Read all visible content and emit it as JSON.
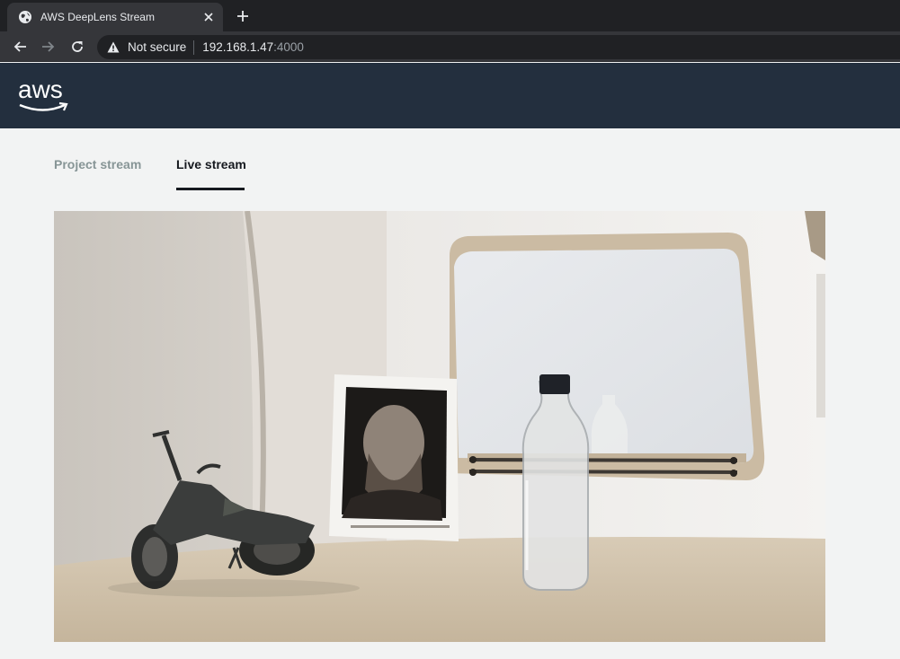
{
  "browser": {
    "tab_title": "AWS DeepLens Stream",
    "security_label": "Not secure",
    "url_host": "192.168.1.47",
    "url_port": ":4000",
    "icons": [
      "globe-icon",
      "close-icon",
      "plus-icon",
      "back-arrow-icon",
      "forward-arrow-icon",
      "reload-icon",
      "warning-icon"
    ]
  },
  "header": {
    "logo_text": "aws",
    "colors": {
      "background": "#232f3e",
      "logo_smile": "#ffffff"
    }
  },
  "tabs": [
    {
      "label": "Project stream",
      "active": false
    },
    {
      "label": "Live stream",
      "active": true
    }
  ],
  "stream": {
    "content": "live camera feed"
  },
  "colors": {
    "page_background": "#f2f3f3",
    "active_tab": "#16191f",
    "inactive_tab": "#879596"
  }
}
